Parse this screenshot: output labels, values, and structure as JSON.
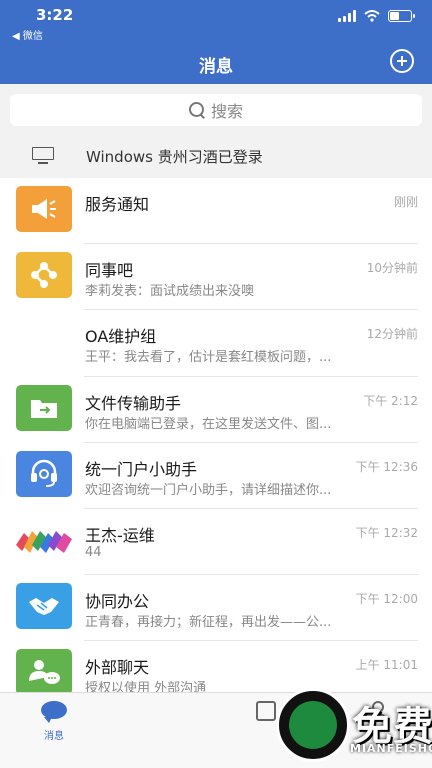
{
  "status": {
    "time": "3:22",
    "back_app": "◀ 微信"
  },
  "header": {
    "title": "消息"
  },
  "search": {
    "placeholder": "搜索"
  },
  "login_bar": {
    "text": "Windows 贵州习酒已登录"
  },
  "conversations": [
    {
      "name": "服务通知",
      "time": "刚刚",
      "preview": "",
      "avatar": "megaphone-icon"
    },
    {
      "name": "同事吧",
      "time": "10分钟前",
      "preview": "李莉发表：面试成绩出来没噢",
      "avatar": "share-nodes-icon"
    },
    {
      "name": "OA维护组",
      "time": "12分钟前",
      "preview": "王平：我去看了，估计是套红模板问题，...",
      "avatar": "group-avatar"
    },
    {
      "name": "文件传输助手",
      "time": "下午 2:12",
      "preview": "你在电脑端已登录，在这里发送文件、图...",
      "avatar": "folder-icon"
    },
    {
      "name": "统一门户小助手",
      "time": "下午 12:36",
      "preview": "欢迎咨询统一门户小助手，请详细描述你...",
      "avatar": "headset-icon"
    },
    {
      "name": "王杰-运维",
      "time": "下午 12:32",
      "preview": "44",
      "avatar": "colorful-stripes-avatar"
    },
    {
      "name": "协同办公",
      "time": "下午 12:00",
      "preview": "正青春，再接力；新征程，再出发——公...",
      "avatar": "handshake-icon"
    },
    {
      "name": "外部聊天",
      "time": "上午 11:01",
      "preview": "授权以使用 外部沟通",
      "avatar": "chat-people-icon"
    }
  ],
  "tabbar": {
    "tabs": [
      {
        "label": "消息",
        "icon": "chat-bubble-icon",
        "active": true
      }
    ]
  },
  "watermark": {
    "title": "免费手游网",
    "subtitle": "MIANFEISHOUYOUWANG"
  },
  "colors": {
    "primary": "#3e6fc8",
    "background": "#f2f2f2"
  }
}
